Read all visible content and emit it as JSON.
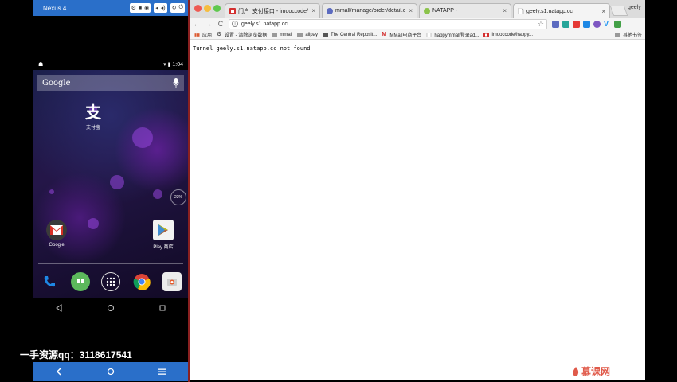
{
  "emulator": {
    "title": "Nexus 4",
    "status_time": "1:04",
    "google_search_text": "Google",
    "apps": {
      "alipay_label": "支付宝",
      "gmail_label": "Google",
      "play_label": "Play 商店"
    },
    "battery_widget": "23%",
    "watermark": "一手资源qq：3118617541"
  },
  "browser": {
    "profile": "geely",
    "tabs": [
      {
        "label": "门户_支付接口 - imooccode/hi"
      },
      {
        "label": "mmall/manage/order/detail.d"
      },
      {
        "label": "NATAPP -"
      },
      {
        "label": "geely.s1.natapp.cc"
      }
    ],
    "url": "geely.s1.natapp.cc",
    "bookmarks": [
      {
        "label": "应用"
      },
      {
        "label": "设置 - 清除浏览数据"
      },
      {
        "label": "mmall"
      },
      {
        "label": "alipay"
      },
      {
        "label": "The Central Reposit..."
      },
      {
        "label": "MMall电商平台"
      },
      {
        "label": "happymmall登录ad..."
      },
      {
        "label": "imooccode/happy..."
      }
    ],
    "other_bookmarks": "其他书签",
    "page_text": "Tunnel geely.s1.natapp.cc not found"
  },
  "brand_watermark": "慕课网",
  "colors": {
    "emulator_bar": "#2a6fc9",
    "tab_bg": "#e8e8e8",
    "brand": "#e05a4a"
  }
}
